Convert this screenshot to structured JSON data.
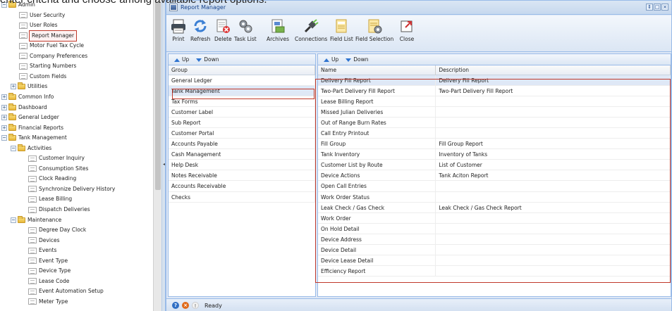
{
  "caption": "enter criteria and choose among available report options.",
  "tree": {
    "items": [
      {
        "label": "Admin",
        "kind": "folder",
        "expanded": true,
        "level": 0
      },
      {
        "label": "User Security",
        "kind": "leaf",
        "level": 1
      },
      {
        "label": "User Roles",
        "kind": "leaf",
        "level": 1
      },
      {
        "label": "Report Manager",
        "kind": "leaf",
        "level": 1,
        "highlight": true
      },
      {
        "label": "Motor Fuel Tax Cycle",
        "kind": "leaf",
        "level": 1
      },
      {
        "label": "Company Preferences",
        "kind": "leaf",
        "level": 1
      },
      {
        "label": "Starting Numbers",
        "kind": "leaf",
        "level": 1
      },
      {
        "label": "Custom Fields",
        "kind": "leaf",
        "level": 1
      },
      {
        "label": "Utilities",
        "kind": "folder",
        "expanded": false,
        "level": 1
      },
      {
        "label": "Common Info",
        "kind": "folder",
        "expanded": false,
        "level": 0
      },
      {
        "label": "Dashboard",
        "kind": "folder",
        "expanded": false,
        "level": 0
      },
      {
        "label": "General Ledger",
        "kind": "folder",
        "expanded": false,
        "level": 0
      },
      {
        "label": "Financial Reports",
        "kind": "folder",
        "expanded": false,
        "level": 0
      },
      {
        "label": "Tank Management",
        "kind": "folder",
        "expanded": true,
        "level": 0
      },
      {
        "label": "Activities",
        "kind": "folder",
        "expanded": true,
        "level": 1
      },
      {
        "label": "Customer Inquiry",
        "kind": "leaf",
        "level": 2
      },
      {
        "label": "Consumption Sites",
        "kind": "leaf",
        "level": 2
      },
      {
        "label": "Clock Reading",
        "kind": "leaf",
        "level": 2
      },
      {
        "label": "Synchronize Delivery History",
        "kind": "leaf",
        "level": 2
      },
      {
        "label": "Lease Billing",
        "kind": "leaf",
        "level": 2
      },
      {
        "label": "Dispatch Deliveries",
        "kind": "leaf",
        "level": 2
      },
      {
        "label": "Maintenance",
        "kind": "folder",
        "expanded": true,
        "level": 1
      },
      {
        "label": "Degree Day Clock",
        "kind": "leaf",
        "level": 2
      },
      {
        "label": "Devices",
        "kind": "leaf",
        "level": 2
      },
      {
        "label": "Events",
        "kind": "leaf",
        "level": 2
      },
      {
        "label": "Event Type",
        "kind": "leaf",
        "level": 2
      },
      {
        "label": "Device Type",
        "kind": "leaf",
        "level": 2
      },
      {
        "label": "Lease Code",
        "kind": "leaf",
        "level": 2
      },
      {
        "label": "Event Automation Setup",
        "kind": "leaf",
        "level": 2
      },
      {
        "label": "Meter Type",
        "kind": "leaf",
        "level": 2
      }
    ]
  },
  "window": {
    "title": "Report Manager",
    "toolbar": [
      {
        "label": "Print",
        "icon": "printer-icon"
      },
      {
        "label": "Refresh",
        "icon": "refresh-icon"
      },
      {
        "label": "Delete",
        "icon": "delete-icon"
      },
      {
        "label": "Task List",
        "icon": "gears-icon"
      },
      {
        "label": "Archives",
        "icon": "archives-icon"
      },
      {
        "label": "Connections",
        "icon": "connections-icon"
      },
      {
        "label": "Field List",
        "icon": "field-list-icon"
      },
      {
        "label": "Field Selection",
        "icon": "field-selection-icon"
      },
      {
        "label": "Close",
        "icon": "close-icon"
      }
    ],
    "left_pane": {
      "up_label": "Up",
      "down_label": "Down",
      "header": "Group",
      "rows": [
        "General Ledger",
        "Tank Management",
        "Tax Forms",
        "Customer Label",
        "Sub Report",
        "Customer Portal",
        "Accounts Payable",
        "Cash Management",
        "Help Desk",
        "Notes Receivable",
        "Accounts Receivable",
        "Checks"
      ],
      "selected_index": 1
    },
    "right_pane": {
      "up_label": "Up",
      "down_label": "Down",
      "headers": [
        "Name",
        "Description"
      ],
      "rows": [
        [
          "Delivery Fill Report",
          "Delivery Fill Report"
        ],
        [
          "Two-Part Delivery Fill Report",
          "Two-Part Delivery Fill Report"
        ],
        [
          "Lease Billing Report",
          ""
        ],
        [
          "Missed Julian Deliveries",
          ""
        ],
        [
          "Out of Range Burn Rates",
          ""
        ],
        [
          "Call Entry Printout",
          ""
        ],
        [
          "Fill Group",
          "Fill Group Report"
        ],
        [
          "Tank Inventory",
          "Inventory of Tanks"
        ],
        [
          "Customer List by Route",
          "List of Customer"
        ],
        [
          "Device Actions",
          "Tank Aciton Report"
        ],
        [
          "Open Call Entries",
          ""
        ],
        [
          "Work Order Status",
          ""
        ],
        [
          "Leak Check / Gas Check",
          "Leak Check / Gas Check Report"
        ],
        [
          "Work Order",
          ""
        ],
        [
          "On Hold Detail",
          ""
        ],
        [
          "Device Address",
          ""
        ],
        [
          "Device Detail",
          ""
        ],
        [
          "Device Lease Detail",
          ""
        ],
        [
          "Efficiency Report",
          ""
        ]
      ],
      "selected_index": 0
    },
    "status": "Ready"
  }
}
